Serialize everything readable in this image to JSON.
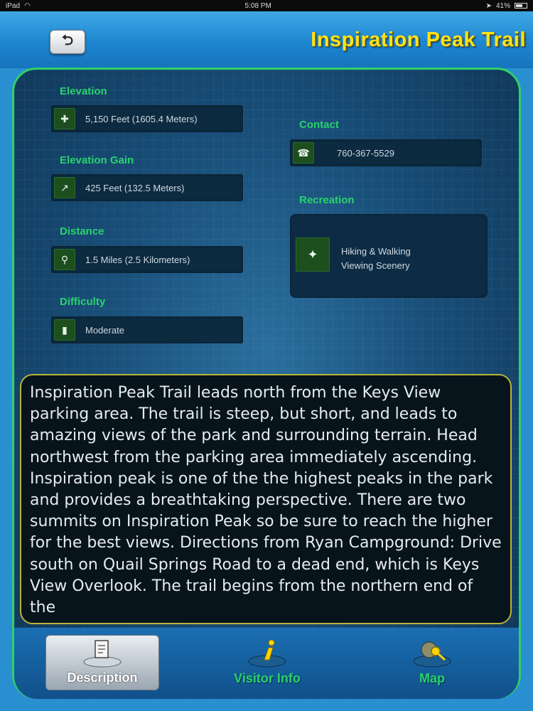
{
  "status_bar": {
    "device": "iPad",
    "time": "5:08 PM",
    "battery": "41%"
  },
  "header": {
    "back_label": "⮌",
    "title": "Inspiration Peak Trail"
  },
  "info": {
    "elevation": {
      "label": "Elevation",
      "value": "5,150 Feet (1605.4 Meters)"
    },
    "elevation_gain": {
      "label": "Elevation Gain",
      "value": "425 Feet (132.5 Meters)"
    },
    "distance": {
      "label": "Distance",
      "value": "1.5 Miles (2.5 Kilometers)"
    },
    "difficulty": {
      "label": "Difficulty",
      "value": "Moderate"
    },
    "contact": {
      "label": "Contact",
      "value": "760-367-5529"
    },
    "recreation": {
      "label": "Recreation",
      "items": [
        "Hiking & Walking",
        "Viewing Scenery"
      ]
    }
  },
  "description": "Inspiration Peak Trail leads north from the Keys View parking area. The trail is steep, but short, and leads to amazing views of the park and surrounding terrain. Head northwest from the parking area immediately ascending. Inspiration peak is one of the the highest peaks in the park and provides a breathtaking perspective. There are two summits on Inspiration Peak so be sure to reach the higher for the best views. Directions from Ryan Campground: Drive south on Quail Springs Road to a dead end, which is Keys View Overlook. The trail begins from the northern end of the",
  "tabs": [
    {
      "label": "Description",
      "icon": "document-icon",
      "active": true
    },
    {
      "label": "Visitor Info",
      "icon": "info-icon",
      "active": false
    },
    {
      "label": "Map",
      "icon": "map-search-icon",
      "active": false
    }
  ],
  "colors": {
    "accent_green": "#29d26d",
    "title_yellow": "#ffe21a",
    "header_blue": "#2a8fd0"
  }
}
